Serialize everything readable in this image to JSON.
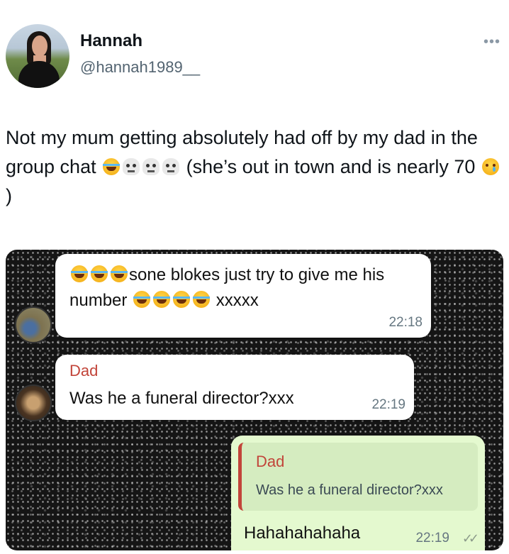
{
  "tweet": {
    "author_name": "Hannah",
    "author_handle": "@hannah1989__",
    "text_part1": "Not my mum getting absolutely had off by my dad in the group chat",
    "text_part2": "(she’s out in town and is nearly 70",
    "text_part3": ")",
    "more_label": "•••"
  },
  "chat": {
    "messages": [
      {
        "text_after_emoji": "sone blokes just try to give me his number",
        "text_end": "xxxxx",
        "time": "22:18"
      },
      {
        "sender": "Dad",
        "text": "Was he a funeral director?xxx",
        "time": "22:19"
      },
      {
        "quoted_sender": "Dad",
        "quoted_text": "Was he a funeral director?xxx",
        "text": "Hahahahahaha",
        "time": "22:19",
        "ticks": "✓✓"
      }
    ]
  },
  "colors": {
    "sender_name": "#c2453a",
    "outgoing_bubble": "#e4f9cf",
    "incoming_bubble": "#ffffff",
    "chat_background": "#151515"
  },
  "icons": [
    "more-icon",
    "laughing-crying-emoji",
    "skull-emoji",
    "crying-face-emoji",
    "read-receipt-icon"
  ]
}
